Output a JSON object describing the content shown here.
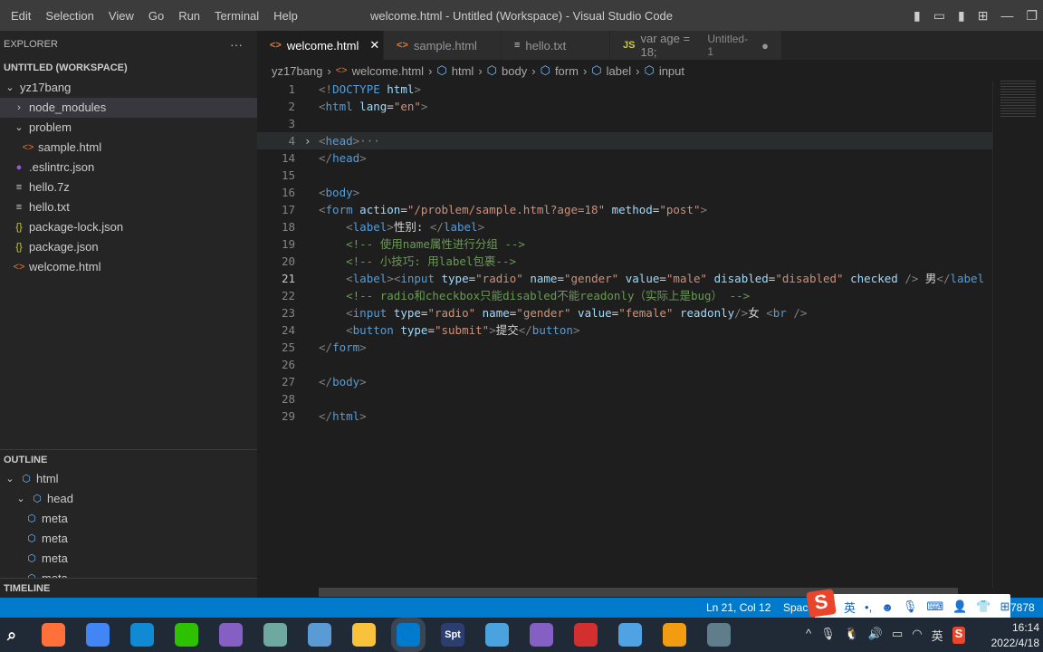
{
  "titlebar": {
    "menu": [
      "Edit",
      "Selection",
      "View",
      "Go",
      "Run",
      "Terminal",
      "Help"
    ],
    "title": "welcome.html - Untitled (Workspace) - Visual Studio Code",
    "minimize": "—",
    "restore": "❐"
  },
  "explorer": {
    "header": "EXPLORER",
    "more": "···",
    "workspace": "UNTITLED (WORKSPACE)",
    "items": [
      {
        "label": "yz17bang",
        "icon": "chevron-down",
        "indent": 0
      },
      {
        "label": "node_modules",
        "icon": "chevron-right",
        "indent": 1,
        "selected": true
      },
      {
        "label": "problem",
        "icon": "chevron-down",
        "indent": 1
      },
      {
        "label": "sample.html",
        "icon": "html",
        "indent": 2
      },
      {
        "label": ".eslintrc.json",
        "icon": "eslint",
        "indent": 1
      },
      {
        "label": "hello.7z",
        "icon": "file-lines",
        "indent": 1
      },
      {
        "label": "hello.txt",
        "icon": "file-lines",
        "indent": 1
      },
      {
        "label": "package-lock.json",
        "icon": "json",
        "indent": 1
      },
      {
        "label": "package.json",
        "icon": "json",
        "indent": 1
      },
      {
        "label": "welcome.html",
        "icon": "html",
        "indent": 1
      }
    ]
  },
  "outline": {
    "header": "OUTLINE",
    "items": [
      {
        "label": "html",
        "indent": 0
      },
      {
        "label": "head",
        "indent": 1
      },
      {
        "label": "meta",
        "indent": 2
      },
      {
        "label": "meta",
        "indent": 2
      },
      {
        "label": "meta",
        "indent": 2
      },
      {
        "label": "meta",
        "indent": 2
      }
    ]
  },
  "timeline": {
    "header": "TIMELINE"
  },
  "tabs": [
    {
      "label": "welcome.html",
      "icon": "html",
      "active": true,
      "close": "✕"
    },
    {
      "label": "sample.html",
      "icon": "html"
    },
    {
      "label": "hello.txt",
      "icon": "file-lines"
    },
    {
      "label": "var age = 18;",
      "desc": "Untitled-1",
      "icon": "js",
      "icon_text": "JS",
      "dirty": "●"
    }
  ],
  "breadcrumb": [
    "yz17bang",
    "welcome.html",
    "html",
    "body",
    "form",
    "label",
    "input"
  ],
  "editor": {
    "current_line": 21,
    "lines": [
      {
        "n": "1",
        "tokens": [
          [
            "p",
            "<!"
          ],
          [
            "t",
            "DOCTYPE "
          ],
          [
            "a",
            "html"
          ],
          [
            "p",
            ">"
          ]
        ]
      },
      {
        "n": "2",
        "tokens": [
          [
            "p",
            "<"
          ],
          [
            "t",
            "html "
          ],
          [
            "a",
            "lang"
          ],
          [
            "x",
            "="
          ],
          [
            "s",
            "\"en\""
          ],
          [
            "p",
            ">"
          ]
        ]
      },
      {
        "n": "3",
        "tokens": []
      },
      {
        "n": "4",
        "fold": "›",
        "hl": true,
        "tokens": [
          [
            "p",
            "<"
          ],
          [
            "t",
            "head"
          ],
          [
            "p",
            ">"
          ],
          [
            "p",
            "···"
          ]
        ]
      },
      {
        "n": "14",
        "tokens": [
          [
            "p",
            "</"
          ],
          [
            "t",
            "head"
          ],
          [
            "p",
            ">"
          ]
        ]
      },
      {
        "n": "15",
        "tokens": []
      },
      {
        "n": "16",
        "tokens": [
          [
            "p",
            "<"
          ],
          [
            "t",
            "body"
          ],
          [
            "p",
            ">"
          ]
        ]
      },
      {
        "n": "17",
        "tokens": [
          [
            "p",
            "<"
          ],
          [
            "t",
            "form "
          ],
          [
            "a",
            "action"
          ],
          [
            "x",
            "="
          ],
          [
            "s",
            "\"/problem/sample.html?age=18\""
          ],
          [
            "a",
            " method"
          ],
          [
            "x",
            "="
          ],
          [
            "s",
            "\"post\""
          ],
          [
            "p",
            ">"
          ]
        ]
      },
      {
        "n": "18",
        "tokens": [
          [
            "x",
            "    "
          ],
          [
            "p",
            "<"
          ],
          [
            "t",
            "label"
          ],
          [
            "p",
            ">"
          ],
          [
            "x",
            "性别: "
          ],
          [
            "p",
            "</"
          ],
          [
            "t",
            "label"
          ],
          [
            "p",
            ">"
          ]
        ]
      },
      {
        "n": "19",
        "tokens": [
          [
            "x",
            "    "
          ],
          [
            "c",
            "<!-- 使用name属性进行分组 -->"
          ]
        ]
      },
      {
        "n": "20",
        "tokens": [
          [
            "x",
            "    "
          ],
          [
            "c",
            "<!-- 小技巧: 用label包裹-->"
          ]
        ]
      },
      {
        "n": "21",
        "tokens": [
          [
            "x",
            "    "
          ],
          [
            "p",
            "<"
          ],
          [
            "t",
            "label"
          ],
          [
            "p",
            ">"
          ],
          [
            "p",
            "<"
          ],
          [
            "t",
            "input "
          ],
          [
            "a",
            "type"
          ],
          [
            "x",
            "="
          ],
          [
            "s",
            "\"radio\""
          ],
          [
            "a",
            " name"
          ],
          [
            "x",
            "="
          ],
          [
            "s",
            "\"gender\""
          ],
          [
            "a",
            " value"
          ],
          [
            "x",
            "="
          ],
          [
            "s",
            "\"male\""
          ],
          [
            "a",
            " disabled"
          ],
          [
            "x",
            "="
          ],
          [
            "s",
            "\"disabled\""
          ],
          [
            "a",
            " checked "
          ],
          [
            "p",
            "/>"
          ],
          [
            "x",
            " 男"
          ],
          [
            "p",
            "</"
          ],
          [
            "t",
            "label"
          ]
        ]
      },
      {
        "n": "22",
        "tokens": [
          [
            "x",
            "    "
          ],
          [
            "c",
            "<!-- radio和checkbox只能disabled不能readonly（实际上是bug） -->"
          ]
        ]
      },
      {
        "n": "23",
        "tokens": [
          [
            "x",
            "    "
          ],
          [
            "p",
            "<"
          ],
          [
            "t",
            "input "
          ],
          [
            "a",
            "type"
          ],
          [
            "x",
            "="
          ],
          [
            "s",
            "\"radio\""
          ],
          [
            "a",
            " name"
          ],
          [
            "x",
            "="
          ],
          [
            "s",
            "\"gender\""
          ],
          [
            "a",
            " value"
          ],
          [
            "x",
            "="
          ],
          [
            "s",
            "\"female\""
          ],
          [
            "a",
            " readonly"
          ],
          [
            "p",
            "/>"
          ],
          [
            "x",
            "女 "
          ],
          [
            "p",
            "<"
          ],
          [
            "t",
            "br "
          ],
          [
            "p",
            "/>"
          ]
        ]
      },
      {
        "n": "24",
        "tokens": [
          [
            "x",
            "    "
          ],
          [
            "p",
            "<"
          ],
          [
            "t",
            "button "
          ],
          [
            "a",
            "type"
          ],
          [
            "x",
            "="
          ],
          [
            "s",
            "\"submit\""
          ],
          [
            "p",
            ">"
          ],
          [
            "x",
            "提交"
          ],
          [
            "p",
            "</"
          ],
          [
            "t",
            "button"
          ],
          [
            "p",
            ">"
          ]
        ]
      },
      {
        "n": "25",
        "tokens": [
          [
            "p",
            "</"
          ],
          [
            "t",
            "form"
          ],
          [
            "p",
            ">"
          ]
        ]
      },
      {
        "n": "26",
        "tokens": []
      },
      {
        "n": "27",
        "tokens": [
          [
            "p",
            "</"
          ],
          [
            "t",
            "body"
          ],
          [
            "p",
            ">"
          ]
        ]
      },
      {
        "n": "28",
        "tokens": []
      },
      {
        "n": "29",
        "tokens": [
          [
            "p",
            "</"
          ],
          [
            "t",
            "html"
          ],
          [
            "p",
            ">"
          ]
        ]
      }
    ]
  },
  "status": {
    "position": "Ln 21, Col 12",
    "spaces": "Spaces",
    "port": "7878"
  },
  "ime": {
    "logo": "S",
    "lang": "英",
    "punct": "•,"
  },
  "tray": {
    "lang": "英",
    "time": "16:14",
    "date": "2022/4/18"
  },
  "taskbar_apps": [
    "search",
    "firefox",
    "chrome",
    "edge",
    "wechat",
    "visual-studio",
    "notepad",
    "paint",
    "file-explorer",
    "vscode",
    "spt",
    "app",
    "visual-studio",
    "wps",
    "qq-browser",
    "weather",
    "calculator"
  ],
  "taskbar_spt": "Spt",
  "colors": {
    "accent": "#007acc",
    "tag": "#569cd6",
    "attr": "#9cdcfe",
    "string": "#ce9178",
    "comment": "#6a9955"
  }
}
